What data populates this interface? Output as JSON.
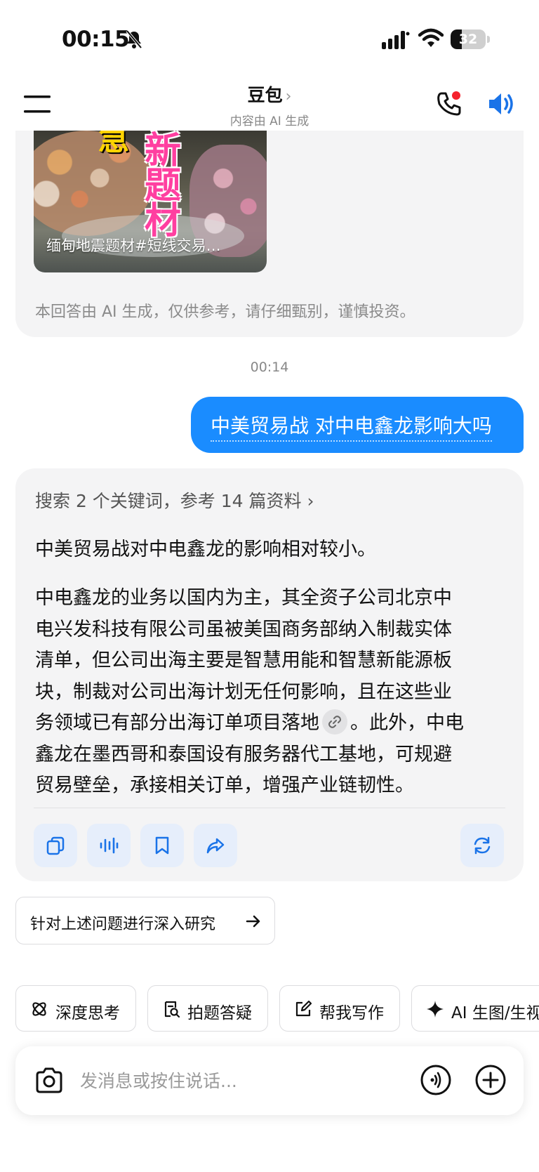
{
  "status_bar": {
    "time": "00:15",
    "battery": "32",
    "battery_level": 0.32,
    "icons": [
      "bell-slash-icon",
      "signal-icon",
      "wifi-icon",
      "battery-icon"
    ]
  },
  "nav": {
    "title": "豆包",
    "chevron": "›",
    "subtitle": "内容由 AI 生成",
    "icons": [
      "menu-icon",
      "phone-icon",
      "speaker-icon"
    ]
  },
  "previous_message": {
    "image_chars_pink": [
      "新",
      "题",
      "材"
    ],
    "image_char_yellow": "急",
    "image_caption": "缅甸地震题材#短线交易…",
    "disclaimer": "本回答由 AI 生成，仅供参考，请仔细甄别，谨慎投资。"
  },
  "timestamp": "00:14",
  "user_message": "中美贸易战 对中电鑫龙影响大吗",
  "answer": {
    "search_summary": "搜索 2 个关键词，参考 14 篇资料",
    "search_chevron": "›",
    "p1": "中美贸易战对中电鑫龙的影响相对较小。",
    "p2_lines": [
      "中电鑫龙的业务以国内为主，其全资子公司北京中",
      "电兴发科技有限公司虽被美国商务部纳入制裁实体",
      "清单，但公司出海主要是智慧用能和智慧新能源板",
      "块，制裁对公司出海计划无任何影响，且在这些业",
      "务领域已有部分出海订单项目落地",
      "。此外，中电",
      "鑫龙在墨西哥和泰国设有服务器代工基地，可规避",
      "贸易壁垒，承接相关订单，增强产业链韧性。"
    ],
    "actions": [
      "copy-icon",
      "voice-wave-icon",
      "bookmark-icon",
      "share-icon",
      "regenerate-icon"
    ]
  },
  "deep_research": {
    "label": "针对上述问题进行深入研究",
    "arrow": "→"
  },
  "chips": [
    {
      "label": "深度思考",
      "icon": "atom-icon"
    },
    {
      "label": "拍题答疑",
      "icon": "search-doc-icon"
    },
    {
      "label": "帮我写作",
      "icon": "edit-icon"
    },
    {
      "label": "AI 生图/生视",
      "icon": "sparkle-icon"
    }
  ],
  "input": {
    "placeholder": "发消息或按住说话...",
    "value": ""
  },
  "colors": {
    "accent": "#1a8cff",
    "card_bg": "#f4f4f5",
    "action_bg": "#e6eefb",
    "red_dot": "#f5222d"
  }
}
